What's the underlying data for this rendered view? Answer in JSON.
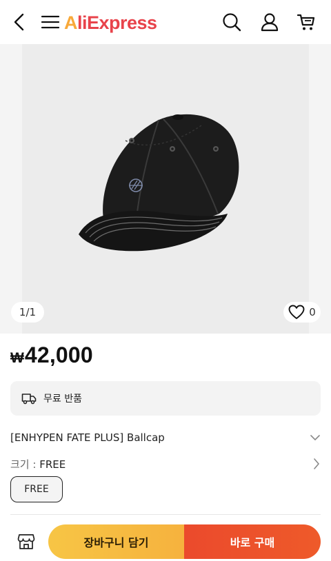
{
  "header": {
    "logo_first_letter": "A",
    "logo_rest": "liExpress"
  },
  "gallery": {
    "counter": "1/1",
    "like_count": "0"
  },
  "product": {
    "currency": "₩",
    "price": "42,000",
    "shipping_label": "무료 반품",
    "title": "[ENHYPEN FATE PLUS] Ballcap",
    "size_label": "크기 : ",
    "size_value": "FREE",
    "size_options": [
      "FREE"
    ]
  },
  "actions": {
    "add_to_cart": "장바구니 담기",
    "buy_now": "바로 구매"
  },
  "colors": {
    "brand_red": "#e8434b",
    "brand_orange": "#f8a93a",
    "cart_button": "#f6b23e",
    "buy_button": "#eb4a2c"
  }
}
